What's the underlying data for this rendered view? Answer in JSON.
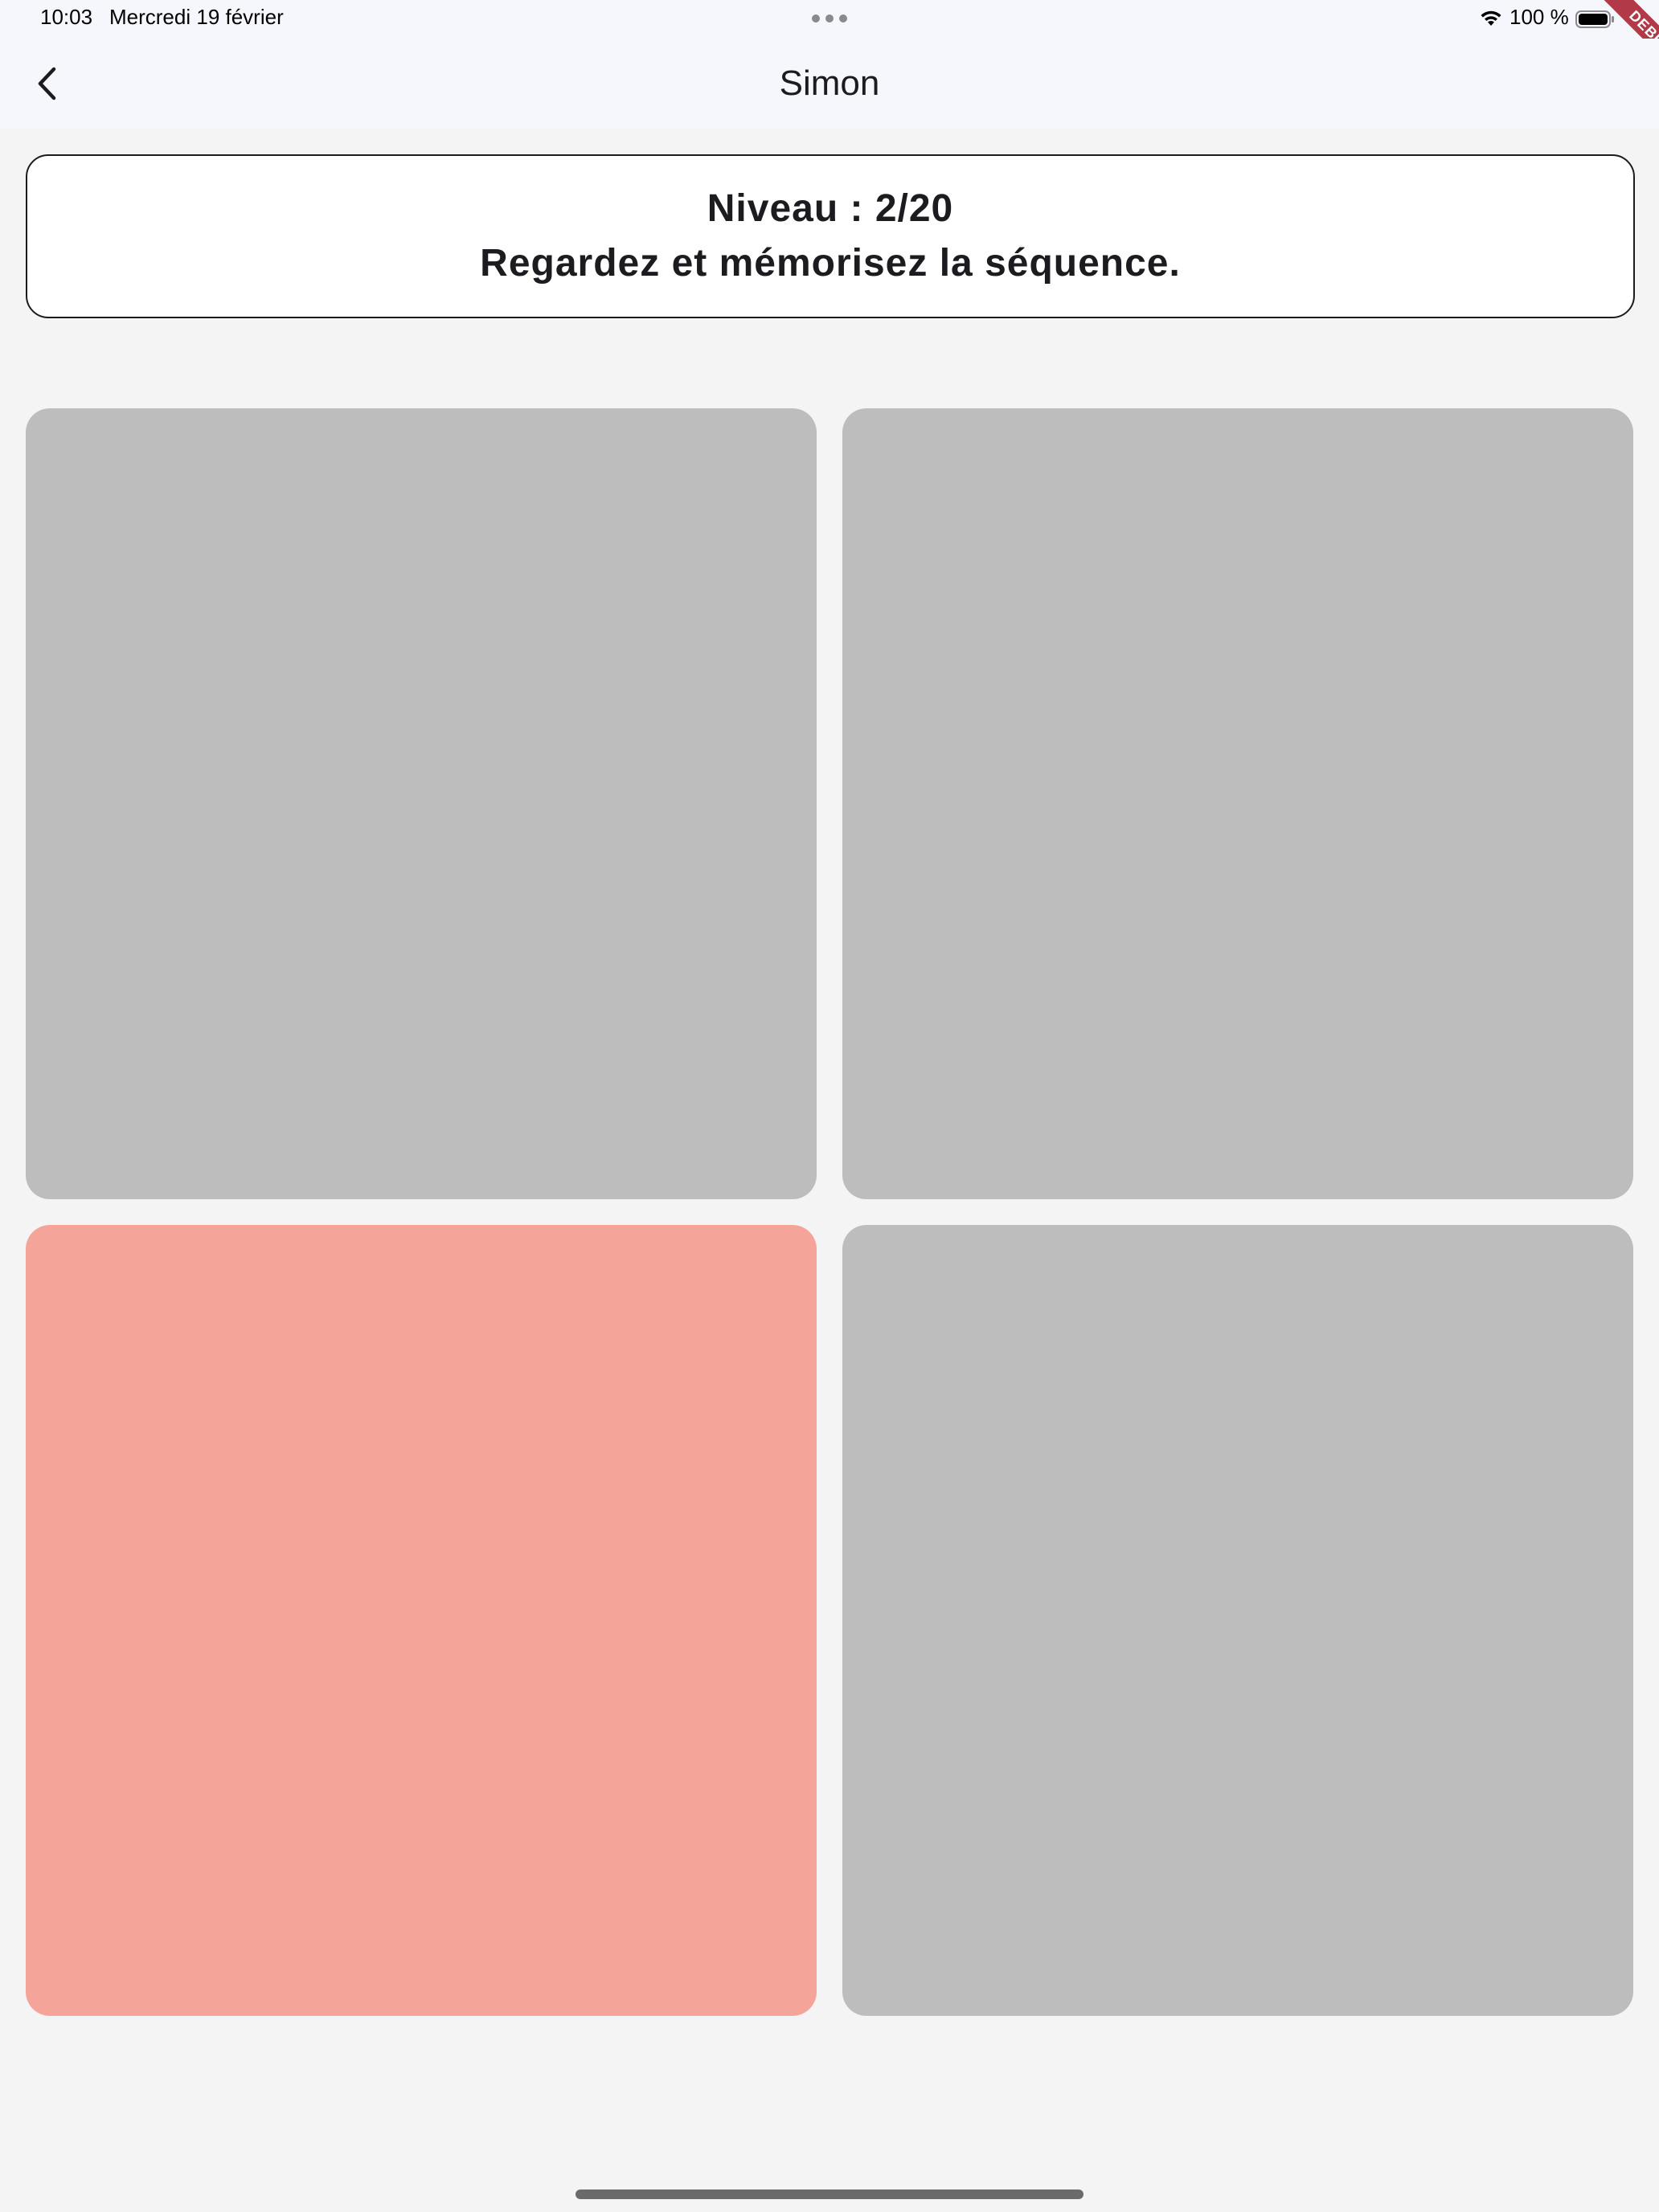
{
  "status_bar": {
    "time": "10:03",
    "date": "Mercredi 19 février",
    "battery": "100 %",
    "icons": [
      "multitasking-dots-icon",
      "wifi-icon",
      "battery-icon"
    ]
  },
  "debug_banner": {
    "label": "DEBUG"
  },
  "nav": {
    "title": "Simon",
    "back_icon": "chevron-left-icon"
  },
  "game": {
    "level_text": "Niveau : 2/20",
    "instruction": "Regardez et mémorisez la séquence."
  },
  "pads": [
    {
      "id": "top-left",
      "color": "#bdbdbd",
      "lit": false
    },
    {
      "id": "top-right",
      "color": "#bdbdbd",
      "lit": false
    },
    {
      "id": "bottom-left",
      "color": "#f5a499",
      "lit": true
    },
    {
      "id": "bottom-right",
      "color": "#bdbdbd",
      "lit": false
    }
  ],
  "colors": {
    "background": "#f4f4f5",
    "nav_background": "#f6f7fc",
    "pad_inactive": "#bdbdbd",
    "pad_active": "#f5a499",
    "debug_ribbon": "#b23a48"
  }
}
